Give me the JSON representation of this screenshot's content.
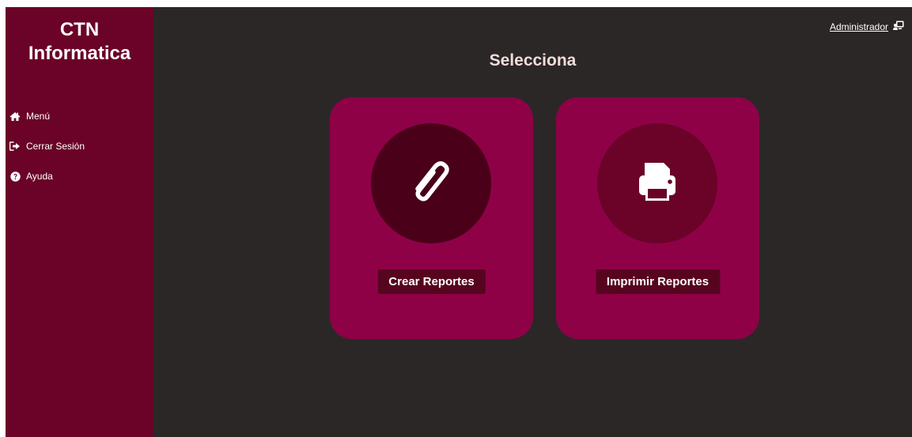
{
  "brand": {
    "line1": "CTN",
    "line2": "Informatica"
  },
  "nav": {
    "items": [
      {
        "label": "Menú",
        "icon": "home-icon"
      },
      {
        "label": "Cerrar Sesión",
        "icon": "sign-out-icon"
      },
      {
        "label": "Ayuda",
        "icon": "question-circle-icon"
      }
    ]
  },
  "header": {
    "user_label": "Administrador",
    "user_icon": "user-monitor-icon"
  },
  "main": {
    "title": "Selecciona",
    "cards": [
      {
        "label": "Crear Reportes",
        "icon": "paperclip-icon",
        "circle_color": "#4a0019"
      },
      {
        "label": "Imprimir Reportes",
        "icon": "print-icon",
        "circle_color": "#6a0327"
      }
    ]
  },
  "colors": {
    "sidebar": "#6a0327",
    "main_bg": "#2b2727",
    "card": "#8e0147",
    "button": "#57051f",
    "title": "#f2dcdc"
  }
}
